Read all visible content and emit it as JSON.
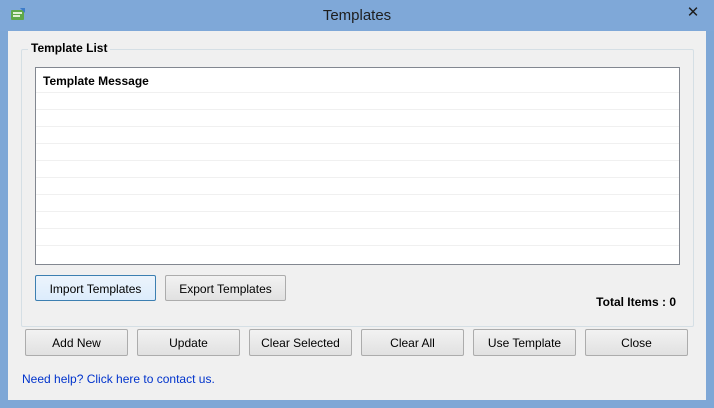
{
  "window": {
    "title": "Templates",
    "close_glyph": "✕",
    "app_icon": "templates-app-icon"
  },
  "group": {
    "label": "Template List"
  },
  "list": {
    "column_header": "Template Message",
    "rows": []
  },
  "import_button": "Import Templates",
  "export_button": "Export Templates",
  "total": {
    "label": "Total Items :",
    "value": "0"
  },
  "actions": {
    "add_new": "Add New",
    "update": "Update",
    "clear_selected": "Clear Selected",
    "clear_all": "Clear All",
    "use_template": "Use Template",
    "close": "Close"
  },
  "help_link": "Need help? Click here to contact us."
}
